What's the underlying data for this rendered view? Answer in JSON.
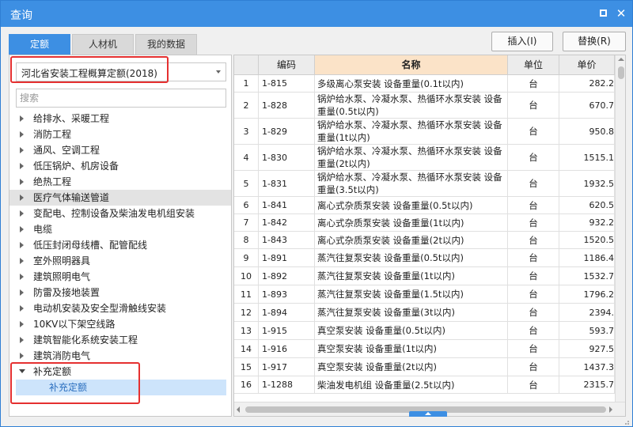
{
  "window": {
    "title": "查询"
  },
  "tabs": [
    {
      "label": "定额",
      "active": true
    },
    {
      "label": "人材机",
      "active": false
    },
    {
      "label": "我的数据",
      "active": false
    }
  ],
  "buttons": {
    "insert": "插入(I)",
    "replace": "替换(R)"
  },
  "combo": {
    "value": "河北省安装工程概算定额(2018)"
  },
  "search": {
    "placeholder": "搜索"
  },
  "tree": {
    "items": [
      {
        "label": "给排水、采暖工程"
      },
      {
        "label": "消防工程"
      },
      {
        "label": "通风、空调工程"
      },
      {
        "label": "低压锅炉、机房设备"
      },
      {
        "label": "绝热工程"
      },
      {
        "label": "医疗气体输送管道"
      },
      {
        "label": "变配电、控制设备及柴油发电机组安装"
      },
      {
        "label": "电缆"
      },
      {
        "label": "低压封闭母线槽、配管配线"
      },
      {
        "label": "室外照明器具"
      },
      {
        "label": "建筑照明电气"
      },
      {
        "label": "防雷及接地装置"
      },
      {
        "label": "电动机安装及安全型滑触线安装"
      },
      {
        "label": "10KV以下架空线路"
      },
      {
        "label": "建筑智能化系统安装工程"
      },
      {
        "label": "建筑消防电气"
      },
      {
        "label": "补充定额"
      }
    ],
    "child": {
      "label": "补充定额"
    }
  },
  "grid": {
    "headers": {
      "index": "",
      "code": "编码",
      "name": "名称",
      "unit": "单位",
      "price": "单价"
    },
    "rows": [
      {
        "i": "1",
        "code": "1-815",
        "name": "多级离心泵安装 设备重量(0.1t以内)",
        "unit": "台",
        "price": "282.2"
      },
      {
        "i": "2",
        "code": "1-828",
        "name": "锅炉给水泵、冷凝水泵、热循环水泵安装 设备重量(0.5t以内)",
        "unit": "台",
        "price": "670.7"
      },
      {
        "i": "3",
        "code": "1-829",
        "name": "锅炉给水泵、冷凝水泵、热循环水泵安装 设备重量(1t以内)",
        "unit": "台",
        "price": "950.8"
      },
      {
        "i": "4",
        "code": "1-830",
        "name": "锅炉给水泵、冷凝水泵、热循环水泵安装 设备重量(2t以内)",
        "unit": "台",
        "price": "1515.1"
      },
      {
        "i": "5",
        "code": "1-831",
        "name": "锅炉给水泵、冷凝水泵、热循环水泵安装 设备重量(3.5t以内)",
        "unit": "台",
        "price": "1932.5"
      },
      {
        "i": "6",
        "code": "1-841",
        "name": "离心式杂质泵安装 设备重量(0.5t以内)",
        "unit": "台",
        "price": "620.5"
      },
      {
        "i": "7",
        "code": "1-842",
        "name": "离心式杂质泵安装 设备重量(1t以内)",
        "unit": "台",
        "price": "932.2"
      },
      {
        "i": "8",
        "code": "1-843",
        "name": "离心式杂质泵安装 设备重量(2t以内)",
        "unit": "台",
        "price": "1520.5"
      },
      {
        "i": "9",
        "code": "1-891",
        "name": "蒸汽往复泵安装 设备重量(0.5t以内)",
        "unit": "台",
        "price": "1186.4"
      },
      {
        "i": "10",
        "code": "1-892",
        "name": "蒸汽往复泵安装 设备重量(1t以内)",
        "unit": "台",
        "price": "1532.7"
      },
      {
        "i": "11",
        "code": "1-893",
        "name": "蒸汽往复泵安装 设备重量(1.5t以内)",
        "unit": "台",
        "price": "1796.2"
      },
      {
        "i": "12",
        "code": "1-894",
        "name": "蒸汽往复泵安装 设备重量(3t以内)",
        "unit": "台",
        "price": "2394."
      },
      {
        "i": "13",
        "code": "1-915",
        "name": "真空泵安装 设备重量(0.5t以内)",
        "unit": "台",
        "price": "593.7"
      },
      {
        "i": "14",
        "code": "1-916",
        "name": "真空泵安装 设备重量(1t以内)",
        "unit": "台",
        "price": "927.5"
      },
      {
        "i": "15",
        "code": "1-917",
        "name": "真空泵安装 设备重量(2t以内)",
        "unit": "台",
        "price": "1437.3"
      },
      {
        "i": "16",
        "code": "1-1288",
        "name": "柴油发电机组 设备重量(2.5t以内)",
        "unit": "台",
        "price": "2315.7"
      }
    ]
  }
}
